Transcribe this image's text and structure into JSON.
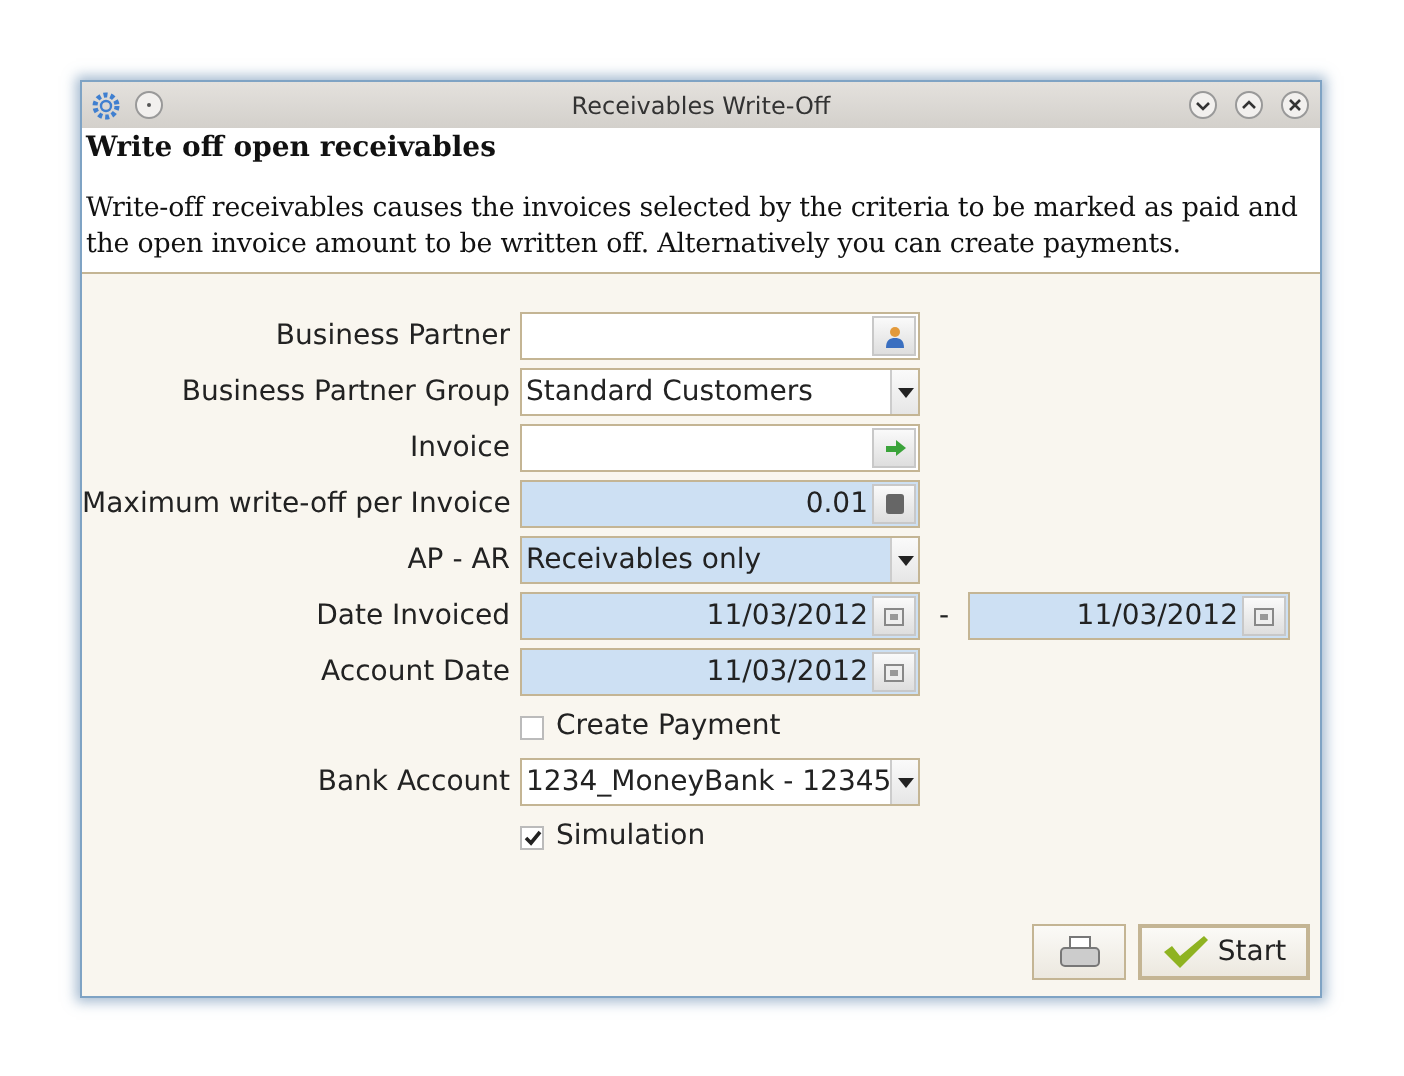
{
  "window": {
    "title": "Receivables Write-Off"
  },
  "header": {
    "title": "Write off open receivables",
    "description": "Write-off receivables causes the invoices selected by the criteria to be marked as paid and the open invoice amount to be written off. Alternatively you can create payments."
  },
  "fields": [
    {
      "kind": "partner-lookup",
      "label": "Business Partner",
      "mandatory": false
    },
    {
      "kind": "select",
      "label": "Business Partner Group",
      "value": "Standard Customers",
      "mandatory": false
    },
    {
      "kind": "invoice-lookup",
      "label": "Invoice",
      "mandatory": false
    },
    {
      "kind": "number",
      "label": "Maximum write-off per Invoice",
      "value": "0.01",
      "mandatory": true
    },
    {
      "kind": "select",
      "label": "AP - AR",
      "value": "Receivables only",
      "mandatory": true
    },
    {
      "kind": "date-range",
      "label": "Date Invoiced",
      "value": "11/03/2012",
      "separator": "-",
      "value_to": "11/03/2012",
      "mandatory": true
    },
    {
      "kind": "date",
      "label": "Account Date",
      "value": "11/03/2012",
      "mandatory": true
    },
    {
      "kind": "checkbox",
      "label": "Create Payment",
      "checked": false
    },
    {
      "kind": "select",
      "label": "Bank Account",
      "value": "1234_MoneyBank - 12345",
      "mandatory": false
    },
    {
      "kind": "checkbox",
      "label": "Simulation",
      "checked": true
    }
  ],
  "buttons": {
    "start": "Start"
  }
}
